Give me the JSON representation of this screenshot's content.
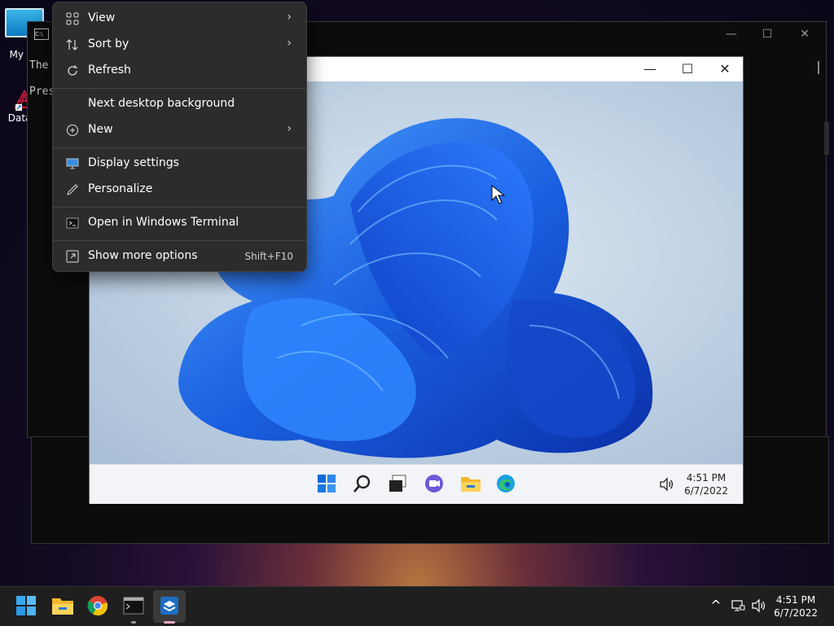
{
  "desktop": {
    "icons": [
      {
        "label": "My Co"
      },
      {
        "label": "DataW"
      }
    ]
  },
  "terminal": {
    "line1": "The",
    "line2": "Pres"
  },
  "context_menu": {
    "items": [
      {
        "label": "View",
        "icon": "grid-icon",
        "submenu": true
      },
      {
        "label": "Sort by",
        "icon": "sort-icon",
        "submenu": true
      },
      {
        "label": "Refresh",
        "icon": "refresh-icon",
        "submenu": false
      },
      {
        "label": "Next desktop background",
        "icon": "",
        "submenu": false
      },
      {
        "label": "New",
        "icon": "plus-circle-icon",
        "submenu": true
      },
      {
        "label": "Display settings",
        "icon": "display-icon",
        "submenu": false
      },
      {
        "label": "Personalize",
        "icon": "pen-icon",
        "submenu": false
      },
      {
        "label": "Open in Windows Terminal",
        "icon": "terminal-icon",
        "submenu": false
      },
      {
        "label": "Show more options",
        "icon": "more-options-icon",
        "shortcut": "Shift+F10"
      }
    ],
    "arrow": "›"
  },
  "vm_window": {
    "controls": {
      "min": "—",
      "max": "☐",
      "close": "✕"
    },
    "taskbar": {
      "time": "4:51 PM",
      "date": "6/7/2022"
    }
  },
  "host_taskbar": {
    "time": "4:51 PM",
    "date": "6/7/2022",
    "chevron": "^"
  },
  "colors": {
    "accent": "#0078d4",
    "bloom": "#1a5fe0",
    "menu_bg": "#2c2c2c"
  }
}
